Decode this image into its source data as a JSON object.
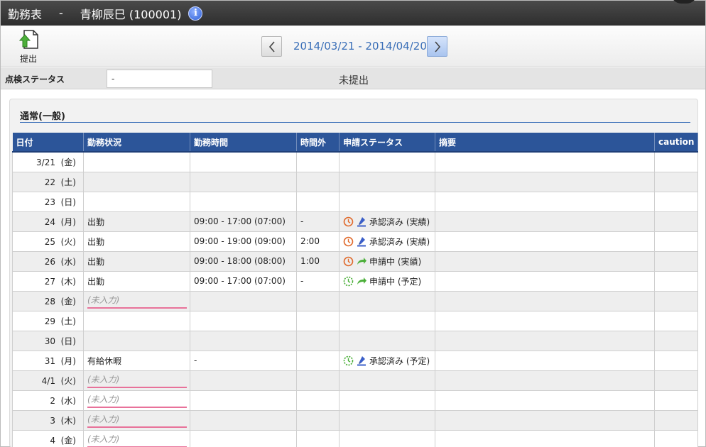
{
  "title": {
    "name": "勤務表",
    "separator": "-",
    "employee": "青柳辰巳 (100001)"
  },
  "toolbar": {
    "submit_label": "提出",
    "period": "2014/03/21 - 2014/04/20"
  },
  "status": {
    "label": "点検ステータス",
    "input_value": "-",
    "state_text": "未提出"
  },
  "section": {
    "title": "通常(一般)"
  },
  "table": {
    "headers": [
      "日付",
      "勤務状況",
      "勤務時間",
      "時間外",
      "申請ステータス",
      "摘要",
      "caution"
    ],
    "rows": [
      {
        "date": "3/21",
        "dow": "(金)",
        "color": "red",
        "work": "",
        "time": "",
        "ot": "",
        "status_text": "",
        "clock": "",
        "mark": ""
      },
      {
        "date": "22",
        "dow": "(土)",
        "color": "blue",
        "work": "",
        "time": "",
        "ot": "",
        "status_text": "",
        "clock": "",
        "mark": ""
      },
      {
        "date": "23",
        "dow": "(日)",
        "color": "red",
        "work": "",
        "time": "",
        "ot": "",
        "status_text": "",
        "clock": "",
        "mark": ""
      },
      {
        "date": "24",
        "dow": "(月)",
        "color": "black",
        "work": "出勤",
        "time": "09:00 - 17:00 (07:00)",
        "ot": "-",
        "status_text": "承認済み (実績)",
        "clock": "orange",
        "mark": "approved"
      },
      {
        "date": "25",
        "dow": "(火)",
        "color": "black",
        "work": "出勤",
        "time": "09:00 - 19:00 (09:00)",
        "ot": "2:00",
        "status_text": "承認済み (実績)",
        "clock": "orange",
        "mark": "approved"
      },
      {
        "date": "26",
        "dow": "(水)",
        "color": "black",
        "work": "出勤",
        "time": "09:00 - 18:00 (08:00)",
        "ot": "1:00",
        "status_text": "申請中 (実績)",
        "clock": "orange",
        "mark": "pending"
      },
      {
        "date": "27",
        "dow": "(木)",
        "color": "black",
        "work": "出勤",
        "time": "09:00 - 17:00 (07:00)",
        "ot": "-",
        "status_text": "申請中 (予定)",
        "clock": "green",
        "mark": "pending"
      },
      {
        "date": "28",
        "dow": "(金)",
        "color": "black",
        "work": "(未入力)",
        "unentered": true,
        "time": "",
        "ot": "",
        "status_text": "",
        "clock": "",
        "mark": ""
      },
      {
        "date": "29",
        "dow": "(土)",
        "color": "blue",
        "work": "",
        "time": "",
        "ot": "",
        "status_text": "",
        "clock": "",
        "mark": ""
      },
      {
        "date": "30",
        "dow": "(日)",
        "color": "red",
        "work": "",
        "time": "",
        "ot": "",
        "status_text": "",
        "clock": "",
        "mark": ""
      },
      {
        "date": "31",
        "dow": "(月)",
        "color": "black",
        "work": "有給休暇",
        "time": "-",
        "ot": "",
        "status_text": "承認済み (予定)",
        "clock": "green",
        "mark": "approved"
      },
      {
        "date": "4/1",
        "dow": "(火)",
        "color": "black",
        "work": "(未入力)",
        "unentered": true,
        "time": "",
        "ot": "",
        "status_text": "",
        "clock": "",
        "mark": ""
      },
      {
        "date": "2",
        "dow": "(水)",
        "color": "black",
        "work": "(未入力)",
        "unentered": true,
        "time": "",
        "ot": "",
        "status_text": "",
        "clock": "",
        "mark": ""
      },
      {
        "date": "3",
        "dow": "(木)",
        "color": "black",
        "work": "(未入力)",
        "unentered": true,
        "time": "",
        "ot": "",
        "status_text": "",
        "clock": "",
        "mark": ""
      },
      {
        "date": "4",
        "dow": "(金)",
        "color": "black",
        "work": "(未入力)",
        "unentered": true,
        "time": "",
        "ot": "",
        "status_text": "",
        "clock": "",
        "mark": ""
      }
    ]
  },
  "icons": {
    "info": "info-icon",
    "submit": "document-upload-icon",
    "prev": "chevron-left-icon",
    "next": "chevron-right-icon"
  },
  "colors": {
    "header_blue": "#2c5599",
    "link_blue": "#3a6fb8",
    "weekend_red": "#d42020",
    "saturday_blue": "#2030c8",
    "unentered_underline": "#e8729a",
    "clock_orange": "#e06a2c",
    "clock_green": "#4caf3a"
  }
}
